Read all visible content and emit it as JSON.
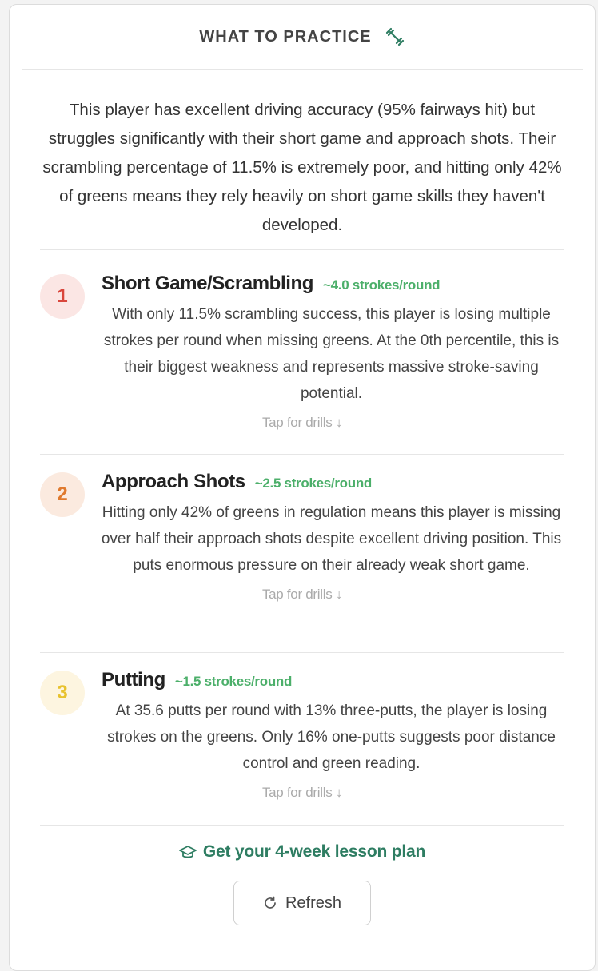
{
  "header": {
    "title": "WHAT TO PRACTICE",
    "icon": "dumbbell-icon"
  },
  "summary": "This player has excellent driving accuracy (95% fairways hit) but struggles significantly with their short game and approach shots. Their scrambling percentage of 11.5% is extremely poor, and hitting only 42% of greens means they rely heavily on short game skills they haven't developed.",
  "items": [
    {
      "rank": "1",
      "title": "Short Game/Scrambling",
      "strokes": "~4.0 strokes/round",
      "description": "With only 11.5% scrambling success, this player is losing multiple strokes per round when missing greens. At the 0th percentile, this is their biggest weakness and represents massive stroke-saving potential.",
      "tap": "Tap for drills ↓",
      "badge_bg": "#fbe6e4",
      "badge_color": "#d9463c"
    },
    {
      "rank": "2",
      "title": "Approach Shots",
      "strokes": "~2.5 strokes/round",
      "description": "Hitting only 42% of greens in regulation means this player is missing over half their approach shots despite excellent driving position. This puts enormous pressure on their already weak short game.",
      "tap": "Tap for drills ↓",
      "badge_bg": "#fbeadf",
      "badge_color": "#e07a2e"
    },
    {
      "rank": "3",
      "title": "Putting",
      "strokes": "~1.5 strokes/round",
      "description": "At 35.6 putts per round with 13% three-putts, the player is losing strokes on the greens. Only 16% one-putts suggests poor distance control and green reading.",
      "tap": "Tap for drills ↓",
      "badge_bg": "#fdf5e0",
      "badge_color": "#e8c22e"
    }
  ],
  "footer": {
    "lesson_label": "Get your 4-week lesson plan",
    "lesson_icon": "graduation-cap-icon",
    "refresh_label": "Refresh",
    "refresh_icon": "refresh-icon"
  },
  "colors": {
    "accent": "#2e7d62",
    "strokes": "#4caf6a"
  }
}
